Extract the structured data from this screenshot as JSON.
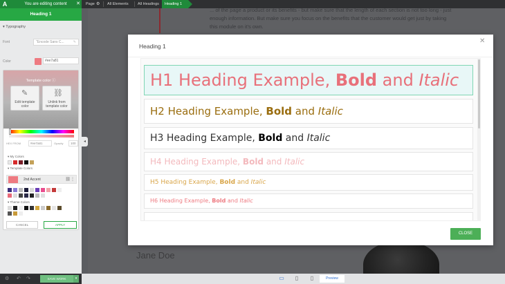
{
  "topbar": {
    "logo": "A",
    "editing_label": "You are editing content",
    "editing_close": "✕",
    "breadcrumbs": [
      "Page",
      "All Elements",
      "All Headings"
    ],
    "active_crumb": "Heading 1"
  },
  "panel": {
    "title": "Heading 1",
    "section": "Typography",
    "font_label": "Font",
    "font_value": "\"Encode Sans C...",
    "color_label": "Color",
    "color_value": "#ee7a81"
  },
  "picker": {
    "template_title": "Template color",
    "edit_template": "Edit template color",
    "unlink_template": "Unlink from template color",
    "hex_label": "HEX FROM",
    "hex_value": "#ee7a81",
    "opacity_label": "Opacity",
    "opacity_value": "100",
    "my_colors_label": "My Colors",
    "template_colors_label": "Template Colors",
    "accent_name": "2nd Accent",
    "theme_colors_label": "Theme Colors",
    "cancel": "CANCEL",
    "apply": "APPLY"
  },
  "bottom": {
    "save": "SAVE WORK",
    "preview": "Preview"
  },
  "background": {
    "text": "... of the page a product or its benefits - but make sure that the length of each section is not too long - just enough information. But make sure you focus on the benefits that the customer would get just by taking this module on it's own.",
    "name": "Jane Doe"
  },
  "modal": {
    "title": "Heading 1",
    "close_label": "CLOSE",
    "headings": [
      {
        "prefix": "H1 Heading Example, ",
        "bold": "Bold",
        "mid": " and ",
        "ital": "Italic"
      },
      {
        "prefix": "H2 Heading Example, ",
        "bold": "Bold",
        "mid": " and ",
        "ital": "Italic"
      },
      {
        "prefix": "H3 Heading Example, ",
        "bold": "Bold",
        "mid": " and ",
        "ital": "Italic"
      },
      {
        "prefix": "H4 Heading Example, ",
        "bold": "Bold",
        "mid": " and ",
        "ital": "Italic"
      },
      {
        "prefix": "H5 Heading Example, ",
        "bold": "Bold",
        "mid": " and ",
        "ital": "Italic"
      },
      {
        "prefix": "H6 Heading Example, ",
        "bold": "Bold",
        "mid": " and ",
        "ital": "Italic"
      }
    ]
  },
  "colors": {
    "accent_green": "#27a844",
    "brand_pink": "#ee7a81",
    "h1": "#e8707a",
    "h2": "#9a6d0f",
    "h3": "#333333",
    "h4": "#f3b9bd",
    "h5": "#d9a64a",
    "h6": "#ee7a81"
  },
  "icons": {
    "logo": "logo-icon",
    "page_settings": "gear-icon",
    "template_info": "info-icon",
    "edit_template": "brush-icon",
    "unlink_template": "unlink-icon",
    "panel_toggle": "chevron-left-icon",
    "desktop": "desktop-icon",
    "tablet": "tablet-icon",
    "mobile": "mobile-icon",
    "modal_close": "close-icon"
  }
}
